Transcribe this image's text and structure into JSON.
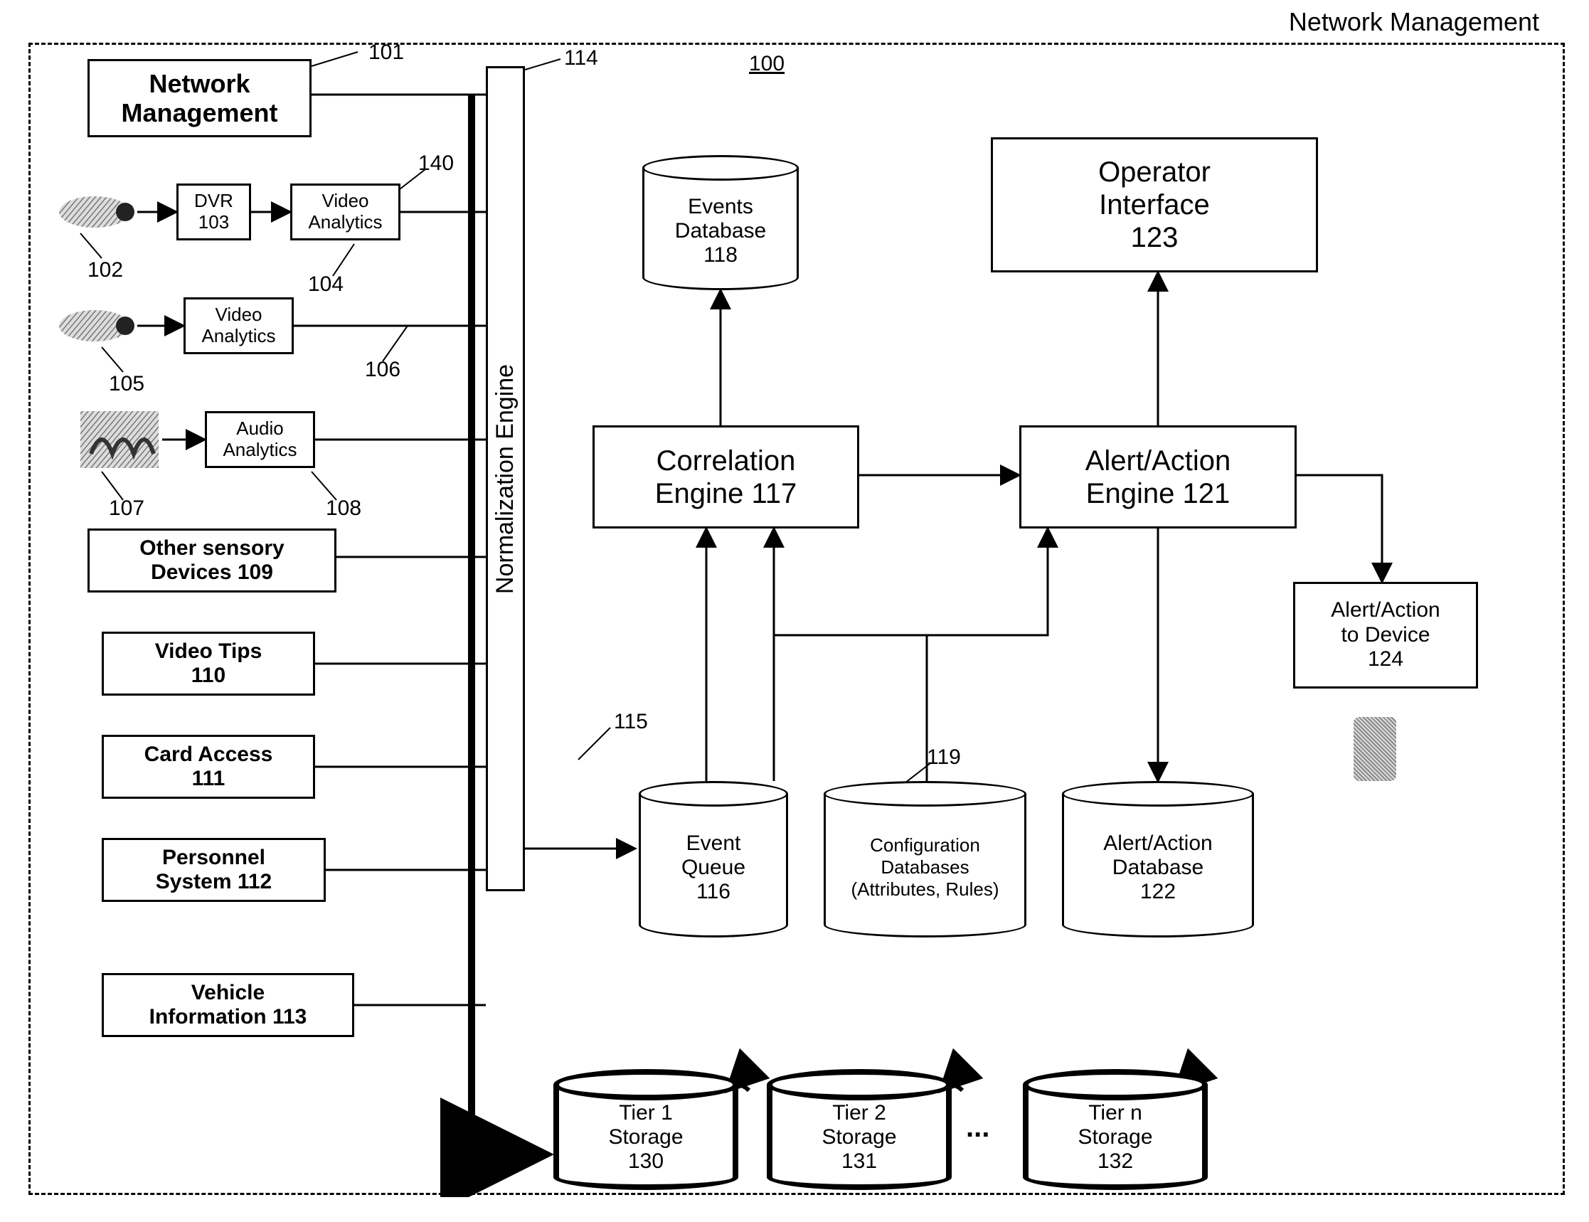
{
  "page_title": "Network Management",
  "system_number": "100",
  "blocks": {
    "network_management": {
      "label": "Network\nManagement",
      "ref": "101"
    },
    "dvr": {
      "label": "DVR\n103"
    },
    "video_analytics_1": {
      "label": "Video\nAnalytics",
      "line_ref": "140",
      "below_ref": "104"
    },
    "video_analytics_2": {
      "label": "Video\nAnalytics",
      "below_ref": "106"
    },
    "audio_analytics": {
      "label": "Audio\nAnalytics",
      "below_ref": "108"
    },
    "other_sensory": {
      "label": "Other sensory\nDevices 109"
    },
    "video_tips": {
      "label": "Video Tips\n110"
    },
    "card_access": {
      "label": "Card Access\n111"
    },
    "personnel": {
      "label": "Personnel\nSystem 112"
    },
    "vehicle_info": {
      "label": "Vehicle\nInformation 113"
    },
    "normalization": {
      "label": "Normalization Engine",
      "ref": "114"
    },
    "event_queue_ref": {
      "ref": "115"
    },
    "events_db": {
      "label": "Events\nDatabase\n118"
    },
    "correlation": {
      "label": "Correlation\nEngine 117"
    },
    "event_queue": {
      "label": "Event\nQueue\n116"
    },
    "config_db": {
      "label": "Configuration\nDatabases\n(Attributes, Rules)",
      "ref": "119"
    },
    "alert_action": {
      "label": "Alert/Action\nEngine 121"
    },
    "alert_db": {
      "label": "Alert/Action\nDatabase\n122"
    },
    "operator_if": {
      "label": "Operator\nInterface\n123"
    },
    "alert_to_device": {
      "label": "Alert/Action\nto Device\n124"
    },
    "tier1": {
      "label": "Tier 1\nStorage\n130"
    },
    "tier2": {
      "label": "Tier 2\nStorage\n131"
    },
    "tiern": {
      "label": "Tier n\nStorage\n132"
    },
    "ellipsis": {
      "label": "..."
    }
  },
  "refs": {
    "cam1": "102",
    "cam2": "105",
    "audio": "107"
  }
}
